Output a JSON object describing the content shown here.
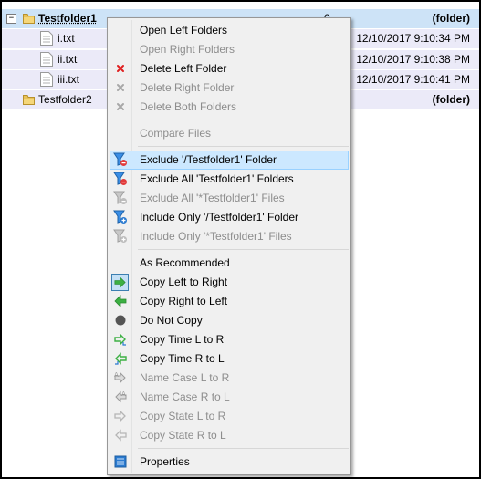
{
  "tree": {
    "rows": [
      {
        "name": "Testfolder1",
        "count": "0",
        "right": "(folder)",
        "expander": "−"
      },
      {
        "name": "i.txt",
        "right": "12/10/2017 9:10:34 PM"
      },
      {
        "name": "ii.txt",
        "right": "12/10/2017 9:10:38 PM"
      },
      {
        "name": "iii.txt",
        "right": "12/10/2017 9:10:41 PM"
      },
      {
        "name": "Testfolder2",
        "right": "(folder)"
      }
    ]
  },
  "menu": {
    "items": [
      {
        "label": "Open Left Folders",
        "enabled": true,
        "icon": "none"
      },
      {
        "label": "Open Right Folders",
        "enabled": false,
        "icon": "none"
      },
      {
        "label": "Delete Left Folder",
        "enabled": true,
        "icon": "delete-red-x-icon"
      },
      {
        "label": "Delete Right Folder",
        "enabled": false,
        "icon": "delete-gray-x-icon"
      },
      {
        "label": "Delete Both Folders",
        "enabled": false,
        "icon": "delete-gray-x-icon"
      },
      {
        "label": "Compare Files",
        "enabled": false,
        "icon": "none"
      },
      {
        "label": "Exclude '/Testfolder1' Folder",
        "enabled": true,
        "icon": "filter-exclude-icon",
        "highlighted": true
      },
      {
        "label": "Exclude All 'Testfolder1' Folders",
        "enabled": true,
        "icon": "filter-exclude-icon"
      },
      {
        "label": "Exclude All '*Testfolder1' Files",
        "enabled": false,
        "icon": "filter-exclude-gray-icon"
      },
      {
        "label": "Include Only '/Testfolder1' Folder",
        "enabled": true,
        "icon": "filter-include-icon"
      },
      {
        "label": "Include Only '*Testfolder1' Files",
        "enabled": false,
        "icon": "filter-include-gray-icon"
      },
      {
        "label": "As Recommended",
        "enabled": true,
        "icon": "none"
      },
      {
        "label": "Copy Left to Right",
        "enabled": true,
        "icon": "arrow-right-green-icon",
        "checked": true
      },
      {
        "label": "Copy Right to Left",
        "enabled": true,
        "icon": "arrow-left-green-icon"
      },
      {
        "label": "Do Not Copy",
        "enabled": true,
        "icon": "dot-icon"
      },
      {
        "label": "Copy Time L to R",
        "enabled": true,
        "icon": "time-right-icon"
      },
      {
        "label": "Copy Time R to L",
        "enabled": true,
        "icon": "time-left-icon"
      },
      {
        "label": "Name Case L to R",
        "enabled": false,
        "icon": "namecase-right-icon"
      },
      {
        "label": "Name Case R to L",
        "enabled": false,
        "icon": "namecase-left-icon"
      },
      {
        "label": "Copy State L to R",
        "enabled": false,
        "icon": "state-right-icon"
      },
      {
        "label": "Copy State R to L",
        "enabled": false,
        "icon": "state-left-icon"
      },
      {
        "label": "Properties",
        "enabled": true,
        "icon": "properties-icon"
      }
    ]
  },
  "colors": {
    "selection": "#cde3f7",
    "menu_highlight": "#cce8ff",
    "green": "#3cb043",
    "red": "#e02020",
    "blue": "#2a7ad0"
  }
}
